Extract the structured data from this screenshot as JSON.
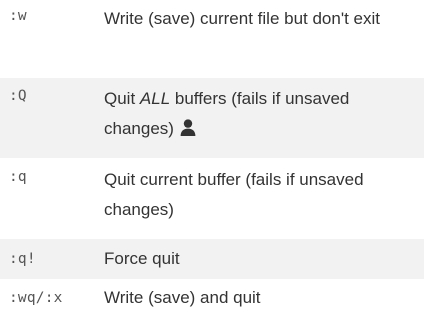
{
  "rows": [
    {
      "command": ":w",
      "description": "Write (save) current file but don't exit"
    },
    {
      "command": ":Q",
      "description_before": "Quit ",
      "description_emphasis": "ALL",
      "description_after": " buffers (fails if unsaved changes)",
      "icon": "user-icon"
    },
    {
      "command": ":q",
      "description": "Quit current buffer (fails if unsaved changes)"
    },
    {
      "command": ":q!",
      "description": "Force quit"
    },
    {
      "command": ":wq/:x",
      "description": "Write (save) and quit"
    }
  ],
  "colors": {
    "shaded_row": "#f2f2f2",
    "command_text": "#555555",
    "description_text": "#333333"
  }
}
